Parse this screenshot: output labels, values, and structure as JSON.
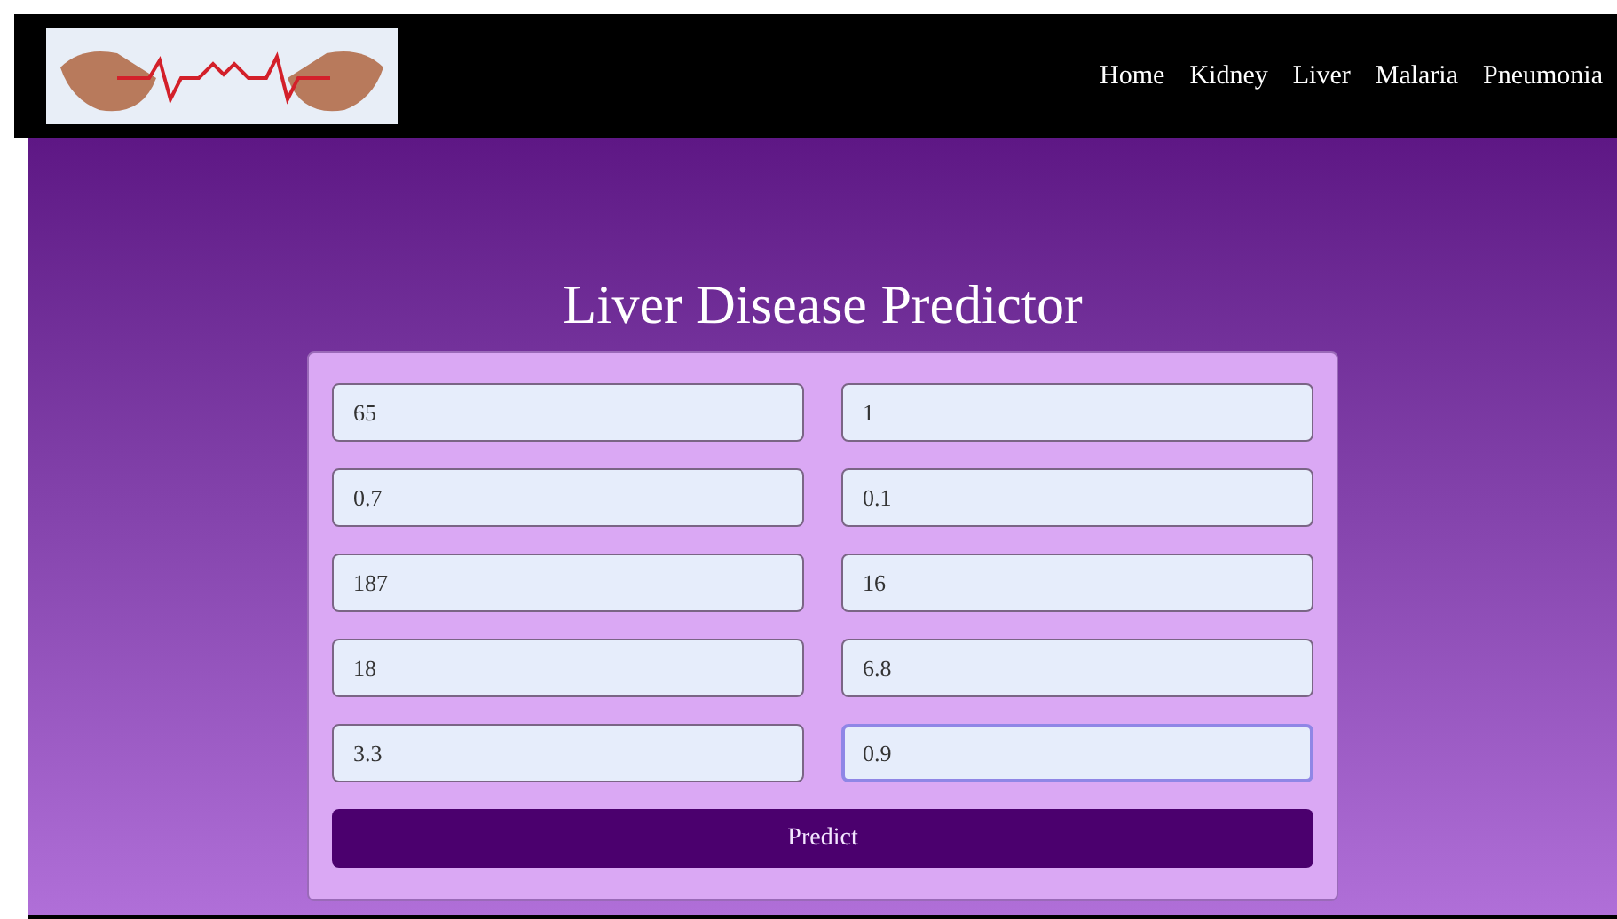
{
  "nav": {
    "links": [
      "Home",
      "Kidney",
      "Liver",
      "Malaria",
      "Pneumonia"
    ]
  },
  "title": "Liver Disease Predictor",
  "fields": [
    {
      "value": "65",
      "focused": false
    },
    {
      "value": "1",
      "focused": false
    },
    {
      "value": "0.7",
      "focused": false
    },
    {
      "value": "0.1",
      "focused": false
    },
    {
      "value": "187",
      "focused": false
    },
    {
      "value": "16",
      "focused": false
    },
    {
      "value": "18",
      "focused": false
    },
    {
      "value": "6.8",
      "focused": false
    },
    {
      "value": "3.3",
      "focused": false
    },
    {
      "value": "0.9",
      "focused": true
    }
  ],
  "button": "Predict"
}
